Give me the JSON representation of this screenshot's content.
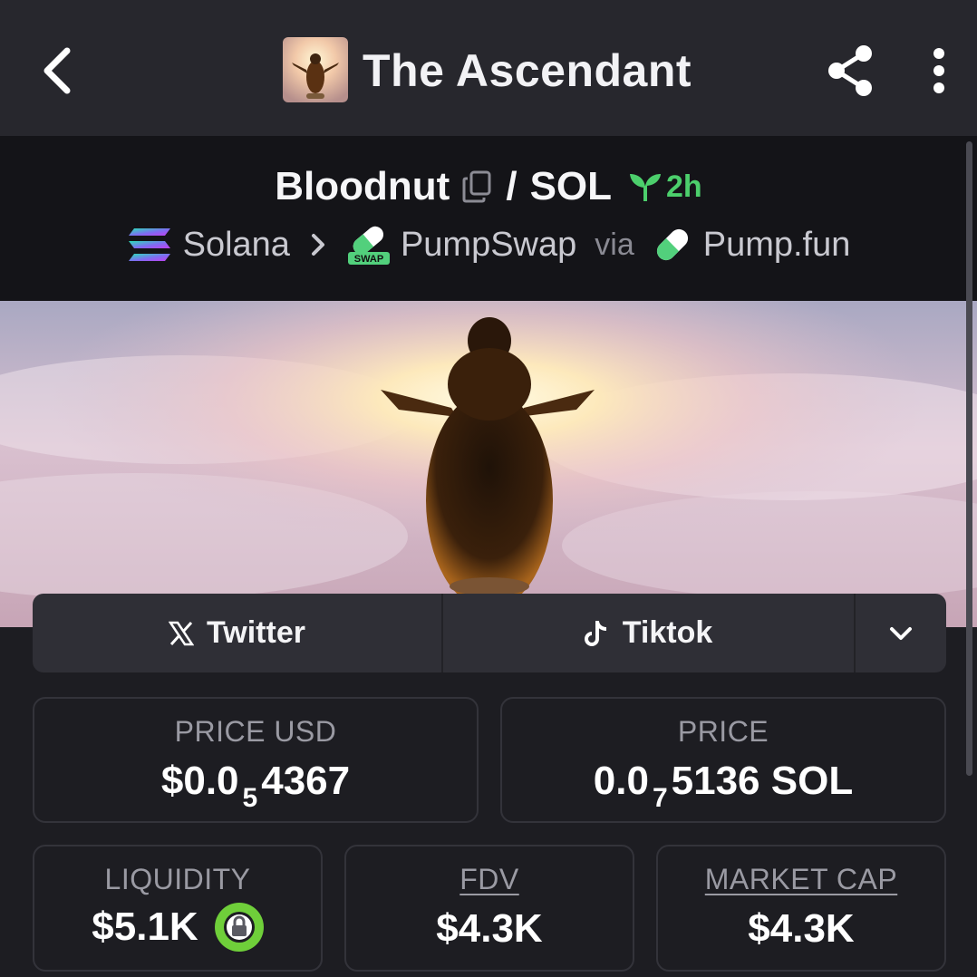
{
  "header": {
    "title": "The Ascendant",
    "back_icon": "chevron-left-icon",
    "share_icon": "share-icon",
    "more_icon": "more-vertical-icon"
  },
  "pair": {
    "base_token": "Bloodnut",
    "separator": "/",
    "quote_token": "SOL",
    "age": "2h",
    "age_color": "#4ccf6c"
  },
  "route": {
    "chain": "Solana",
    "dex": "PumpSwap",
    "dex_badge": "SWAP",
    "via_label": "via",
    "launchpad": "Pump.fun"
  },
  "socials": {
    "twitter_label": "Twitter",
    "tiktok_label": "Tiktok"
  },
  "stats": {
    "price_usd": {
      "label": "PRICE USD",
      "prefix": "$0.0",
      "sub": "5",
      "suffix": "4367"
    },
    "price_sol": {
      "label": "PRICE",
      "prefix": "0.0",
      "sub": "7",
      "suffix": "5136 SOL"
    },
    "liquidity": {
      "label": "LIQUIDITY",
      "value": "$5.1K"
    },
    "fdv": {
      "label": "FDV",
      "value": "$4.3K"
    },
    "market_cap": {
      "label": "MARKET CAP",
      "value": "$4.3K"
    }
  },
  "colors": {
    "background": "#1d1d22",
    "header_bg": "#27272d",
    "pair_bg": "#141418",
    "lock_green": "#6fcf3a"
  }
}
